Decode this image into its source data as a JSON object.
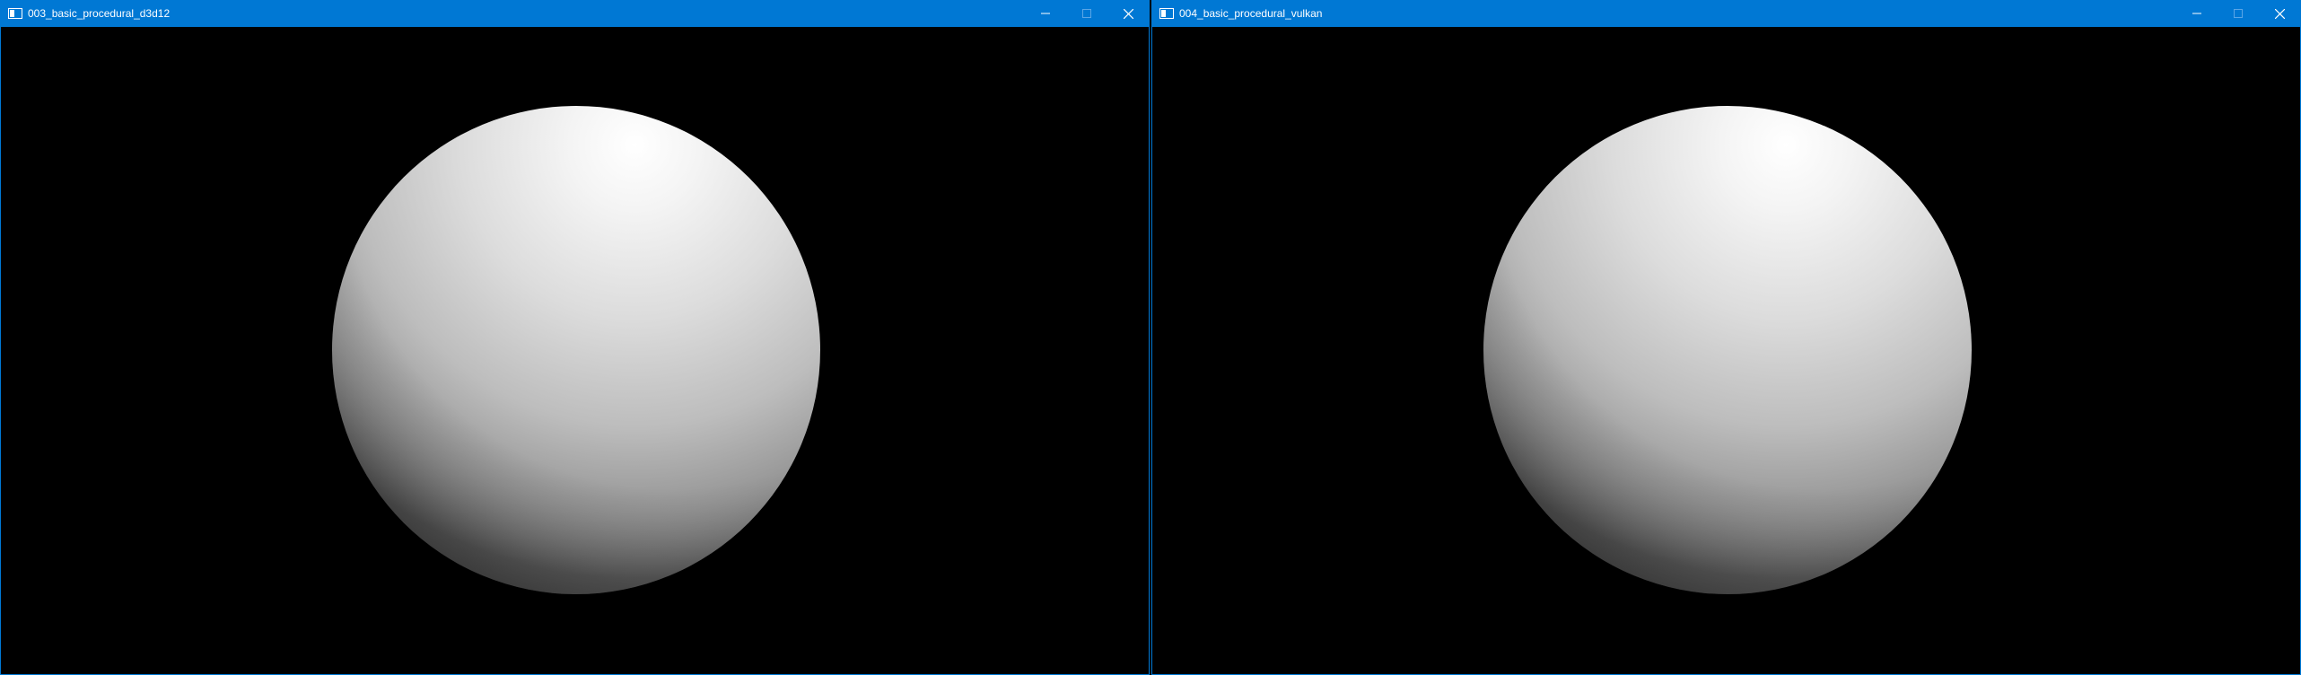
{
  "colors": {
    "titlebar": "#0078d4",
    "title_text": "#ffffff",
    "client_background": "#000000",
    "border": "#0078d4"
  },
  "windows": [
    {
      "title": "003_basic_procedural_d3d12",
      "icon": "app-window-icon",
      "scene": "shaded-sphere",
      "buttons": [
        "minimize-icon",
        "maximize-icon",
        "close-icon"
      ]
    },
    {
      "title": "004_basic_procedural_vulkan",
      "icon": "app-window-icon",
      "scene": "shaded-sphere",
      "buttons": [
        "minimize-icon",
        "maximize-icon",
        "close-icon"
      ]
    }
  ]
}
